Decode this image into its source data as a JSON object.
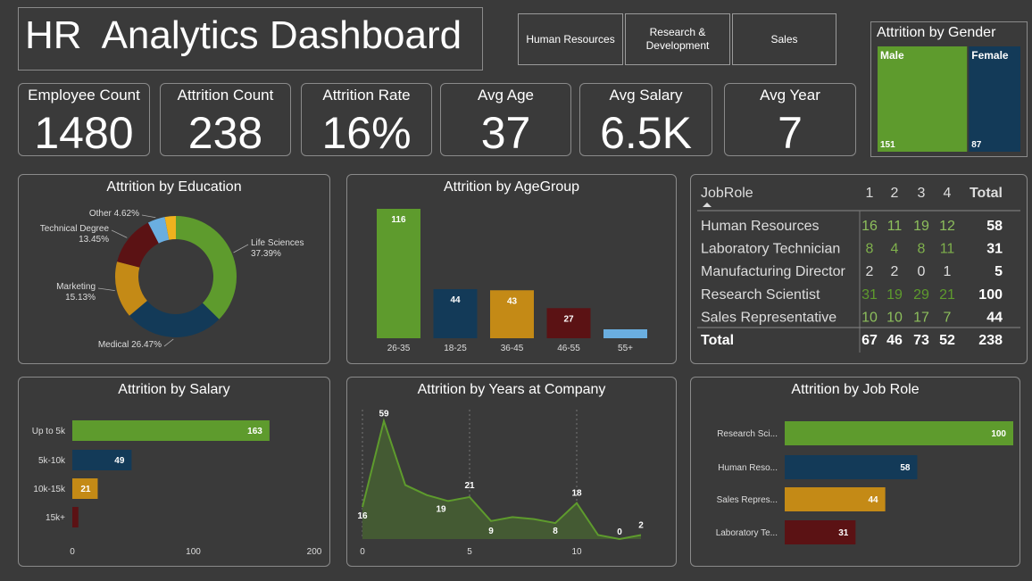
{
  "header": {
    "title": "HR  Analytics Dashboard"
  },
  "slicers": [
    {
      "label": "Human Resources"
    },
    {
      "label": "Research &\nDevelopment"
    },
    {
      "label": "Sales"
    }
  ],
  "kpis": [
    {
      "label": "Employee Count",
      "value": "1480"
    },
    {
      "label": "Attrition Count",
      "value": "238"
    },
    {
      "label": "Attrition Rate",
      "value": "16%"
    },
    {
      "label": "Avg Age",
      "value": "37"
    },
    {
      "label": "Avg Salary",
      "value": "6.5K"
    },
    {
      "label": "Avg Year",
      "value": "7"
    }
  ],
  "colors": {
    "green": "#5e9b2d",
    "navy": "#133a58",
    "gold": "#c48a16",
    "maroon": "#5b1214",
    "lightblue": "#6aaee0",
    "bg": "#3a3a3a"
  },
  "chart_data": [
    {
      "id": "gender",
      "type": "treemap",
      "title": "Attrition by Gender",
      "categories": [
        "Male",
        "Female"
      ],
      "values": [
        151,
        87
      ]
    },
    {
      "id": "education",
      "type": "pie",
      "title": "Attrition by Education",
      "categories": [
        "Life Sciences",
        "Medical",
        "Marketing",
        "Technical Degree",
        "Other",
        ""
      ],
      "values": [
        37.39,
        26.47,
        15.13,
        13.45,
        4.62,
        2.94
      ],
      "labels": [
        "Life Sciences\n37.39%",
        "Medical 26.47%",
        "Marketing\n15.13%",
        "Technical Degree\n13.45%",
        "Other 4.62%",
        ""
      ]
    },
    {
      "id": "agegroup",
      "type": "bar",
      "title": "Attrition by AgeGroup",
      "categories": [
        "26-35",
        "18-25",
        "36-45",
        "46-55",
        "55+"
      ],
      "values": [
        116,
        44,
        43,
        27,
        8
      ],
      "data_labels": [
        "116",
        "44",
        "43",
        "27",
        ""
      ]
    },
    {
      "id": "jobrole_matrix",
      "type": "table",
      "columns": [
        "JobRole",
        "1",
        "2",
        "3",
        "4",
        "Total"
      ],
      "rows": [
        [
          "Human Resources",
          "16",
          "11",
          "19",
          "12",
          "58"
        ],
        [
          "Laboratory Technician",
          "8",
          "4",
          "8",
          "11",
          "31"
        ],
        [
          "Manufacturing Director",
          "2",
          "2",
          "0",
          "1",
          "5"
        ],
        [
          "Research Scientist",
          "31",
          "19",
          "29",
          "21",
          "100"
        ],
        [
          "Sales Representative",
          "10",
          "10",
          "17",
          "7",
          "44"
        ]
      ],
      "total_row": [
        "Total",
        "67",
        "46",
        "73",
        "52",
        "238"
      ]
    },
    {
      "id": "salary",
      "type": "bar",
      "orientation": "horizontal",
      "title": "Attrition by Salary",
      "categories": [
        "Up to 5k",
        "5k-10k",
        "10k-15k",
        "15k+"
      ],
      "values": [
        163,
        49,
        21,
        5
      ],
      "data_labels": [
        "163",
        "49",
        "21",
        ""
      ],
      "xticks": [
        "0",
        "100",
        "200"
      ],
      "xlim": [
        0,
        200
      ]
    },
    {
      "id": "years",
      "type": "area",
      "title": "Attrition by Years at Company",
      "x": [
        0,
        1,
        2,
        3,
        4,
        5,
        6,
        7,
        8,
        9,
        10,
        11,
        12,
        13
      ],
      "values": [
        16,
        59,
        27,
        22,
        19,
        21,
        9,
        11,
        10,
        8,
        18,
        2,
        0,
        2
      ],
      "point_labels": [
        {
          "x": 0,
          "text": "16"
        },
        {
          "x": 1,
          "text": "59"
        },
        {
          "x": 4,
          "text": "19"
        },
        {
          "x": 5,
          "text": "21"
        },
        {
          "x": 6,
          "text": "9"
        },
        {
          "x": 9,
          "text": "8"
        },
        {
          "x": 10,
          "text": "18"
        },
        {
          "x": 12,
          "text": "0"
        },
        {
          "x": 13,
          "text": "2"
        }
      ],
      "xticks": [
        "0",
        "5",
        "10"
      ],
      "ylim": [
        0,
        62
      ]
    },
    {
      "id": "jobrole",
      "type": "bar",
      "orientation": "horizontal",
      "title": "Attrition by Job Role",
      "categories": [
        "Research Sci...",
        "Human Reso...",
        "Sales Repres...",
        "Laboratory Te..."
      ],
      "values": [
        100,
        58,
        44,
        31
      ],
      "data_labels": [
        "100",
        "58",
        "44",
        "31"
      ],
      "xlim": [
        0,
        100
      ]
    }
  ]
}
